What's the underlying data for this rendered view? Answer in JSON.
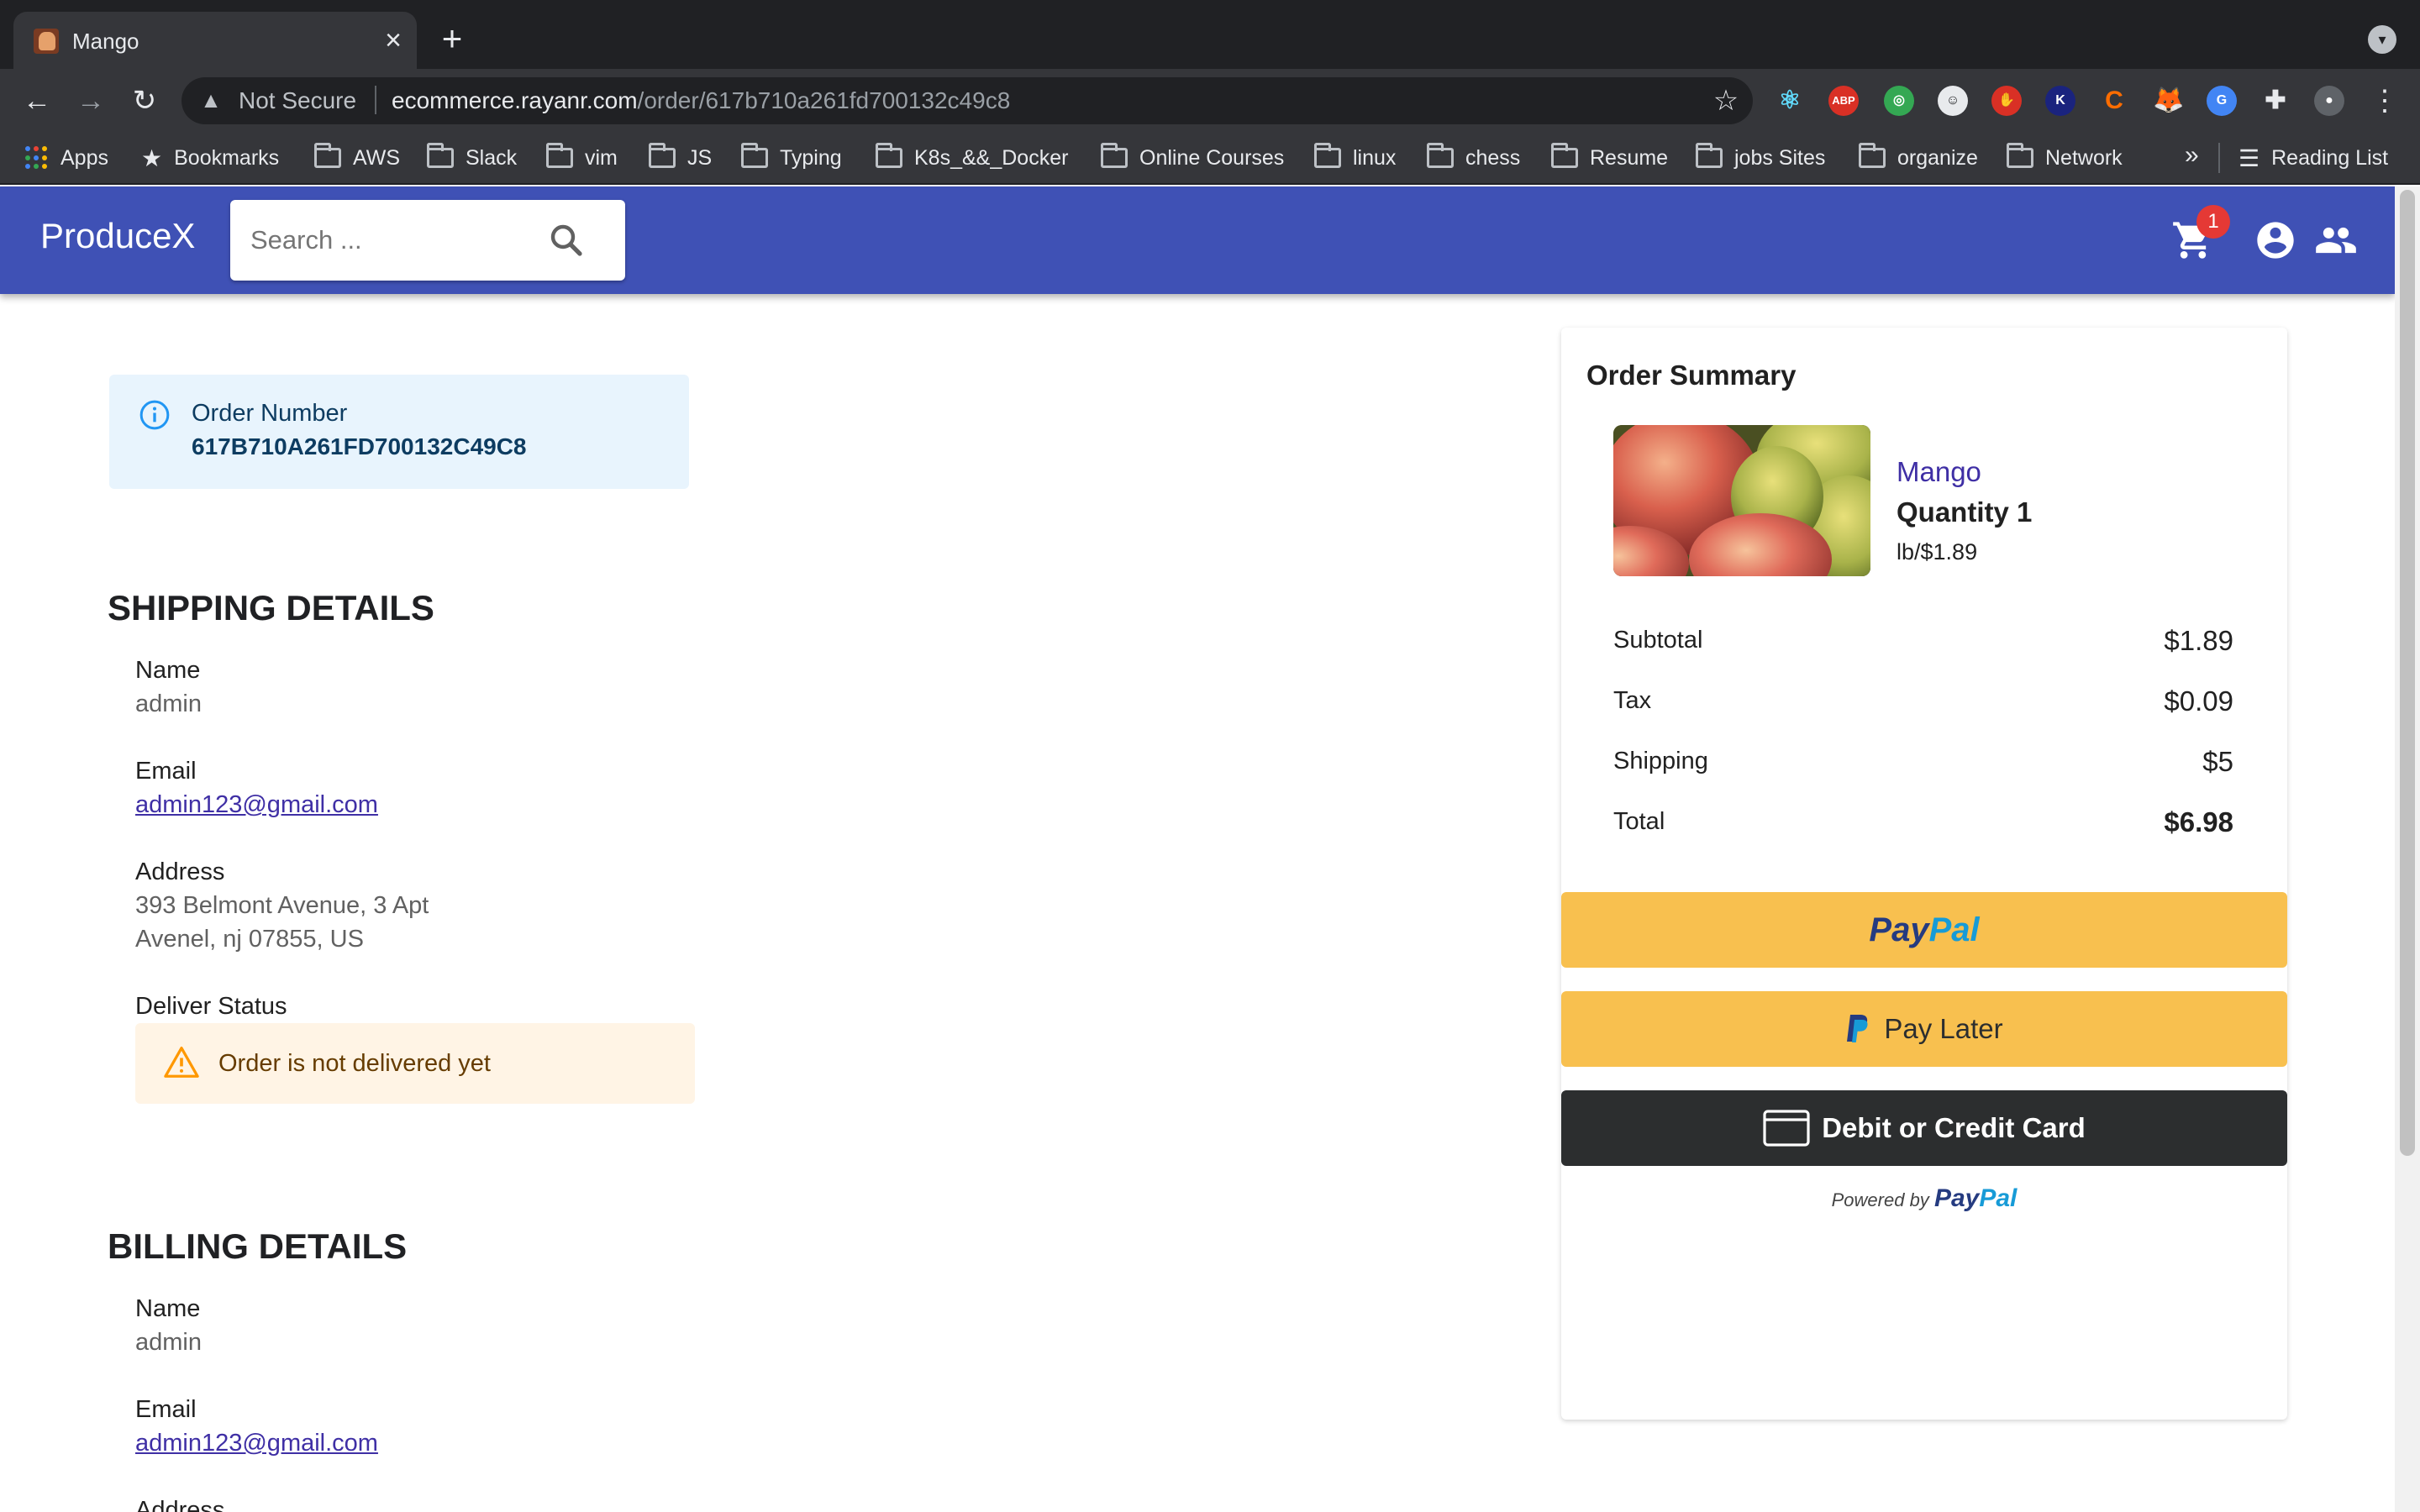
{
  "browser": {
    "tab_title": "Mango",
    "not_secure_label": "Not Secure",
    "url_host": "ecommerce.rayanr.com",
    "url_path": "/order/617b710a261fd700132c49c8",
    "bookmarks": [
      "Apps",
      "Bookmarks",
      "AWS",
      "Slack",
      "vim",
      "JS",
      "Typing",
      "K8s_&&_Docker",
      "Online Courses",
      "linux",
      "chess",
      "Resume",
      "jobs Sites",
      "organize",
      "Network"
    ],
    "bookmarks_more": "»",
    "reading_list": "Reading List",
    "extension_labels": [
      "ABP",
      "K",
      "C",
      "G"
    ]
  },
  "header": {
    "brand": "ProduceX",
    "search_placeholder": "Search ...",
    "cart_count": "1",
    "color": "#3f51b5"
  },
  "order": {
    "number_label": "Order Number",
    "number": "617B710A261FD700132C49C8"
  },
  "shipping": {
    "heading": "SHIPPING DETAILS",
    "name_label": "Name",
    "name": "admin",
    "email_label": "Email",
    "email": "admin123@gmail.com",
    "address_label": "Address",
    "address_line1": "393 Belmont Avenue, 3 Apt",
    "address_line2": "Avenel, nj 07855, US",
    "status_label": "Deliver Status",
    "status": "Order is not delivered yet"
  },
  "billing": {
    "heading": "BILLING DETAILS",
    "name_label": "Name",
    "name": "admin",
    "email_label": "Email",
    "email": "admin123@gmail.com",
    "address_label": "Address"
  },
  "summary": {
    "title": "Order Summary",
    "item": {
      "name": "Mango",
      "quantity": "Quantity 1",
      "price": "lb/$1.89"
    },
    "subtotal_label": "Subtotal",
    "subtotal": "$1.89",
    "tax_label": "Tax",
    "tax": "$0.09",
    "shipping_label": "Shipping",
    "shipping": "$5",
    "total_label": "Total",
    "total": "$6.98"
  },
  "payment": {
    "paypal_pay": "Pay",
    "paypal_pal": "Pal",
    "pay_later": "Pay Later",
    "card": "Debit or Credit Card",
    "powered_by": "Powered by",
    "paypal_color": "#f8c04f"
  }
}
